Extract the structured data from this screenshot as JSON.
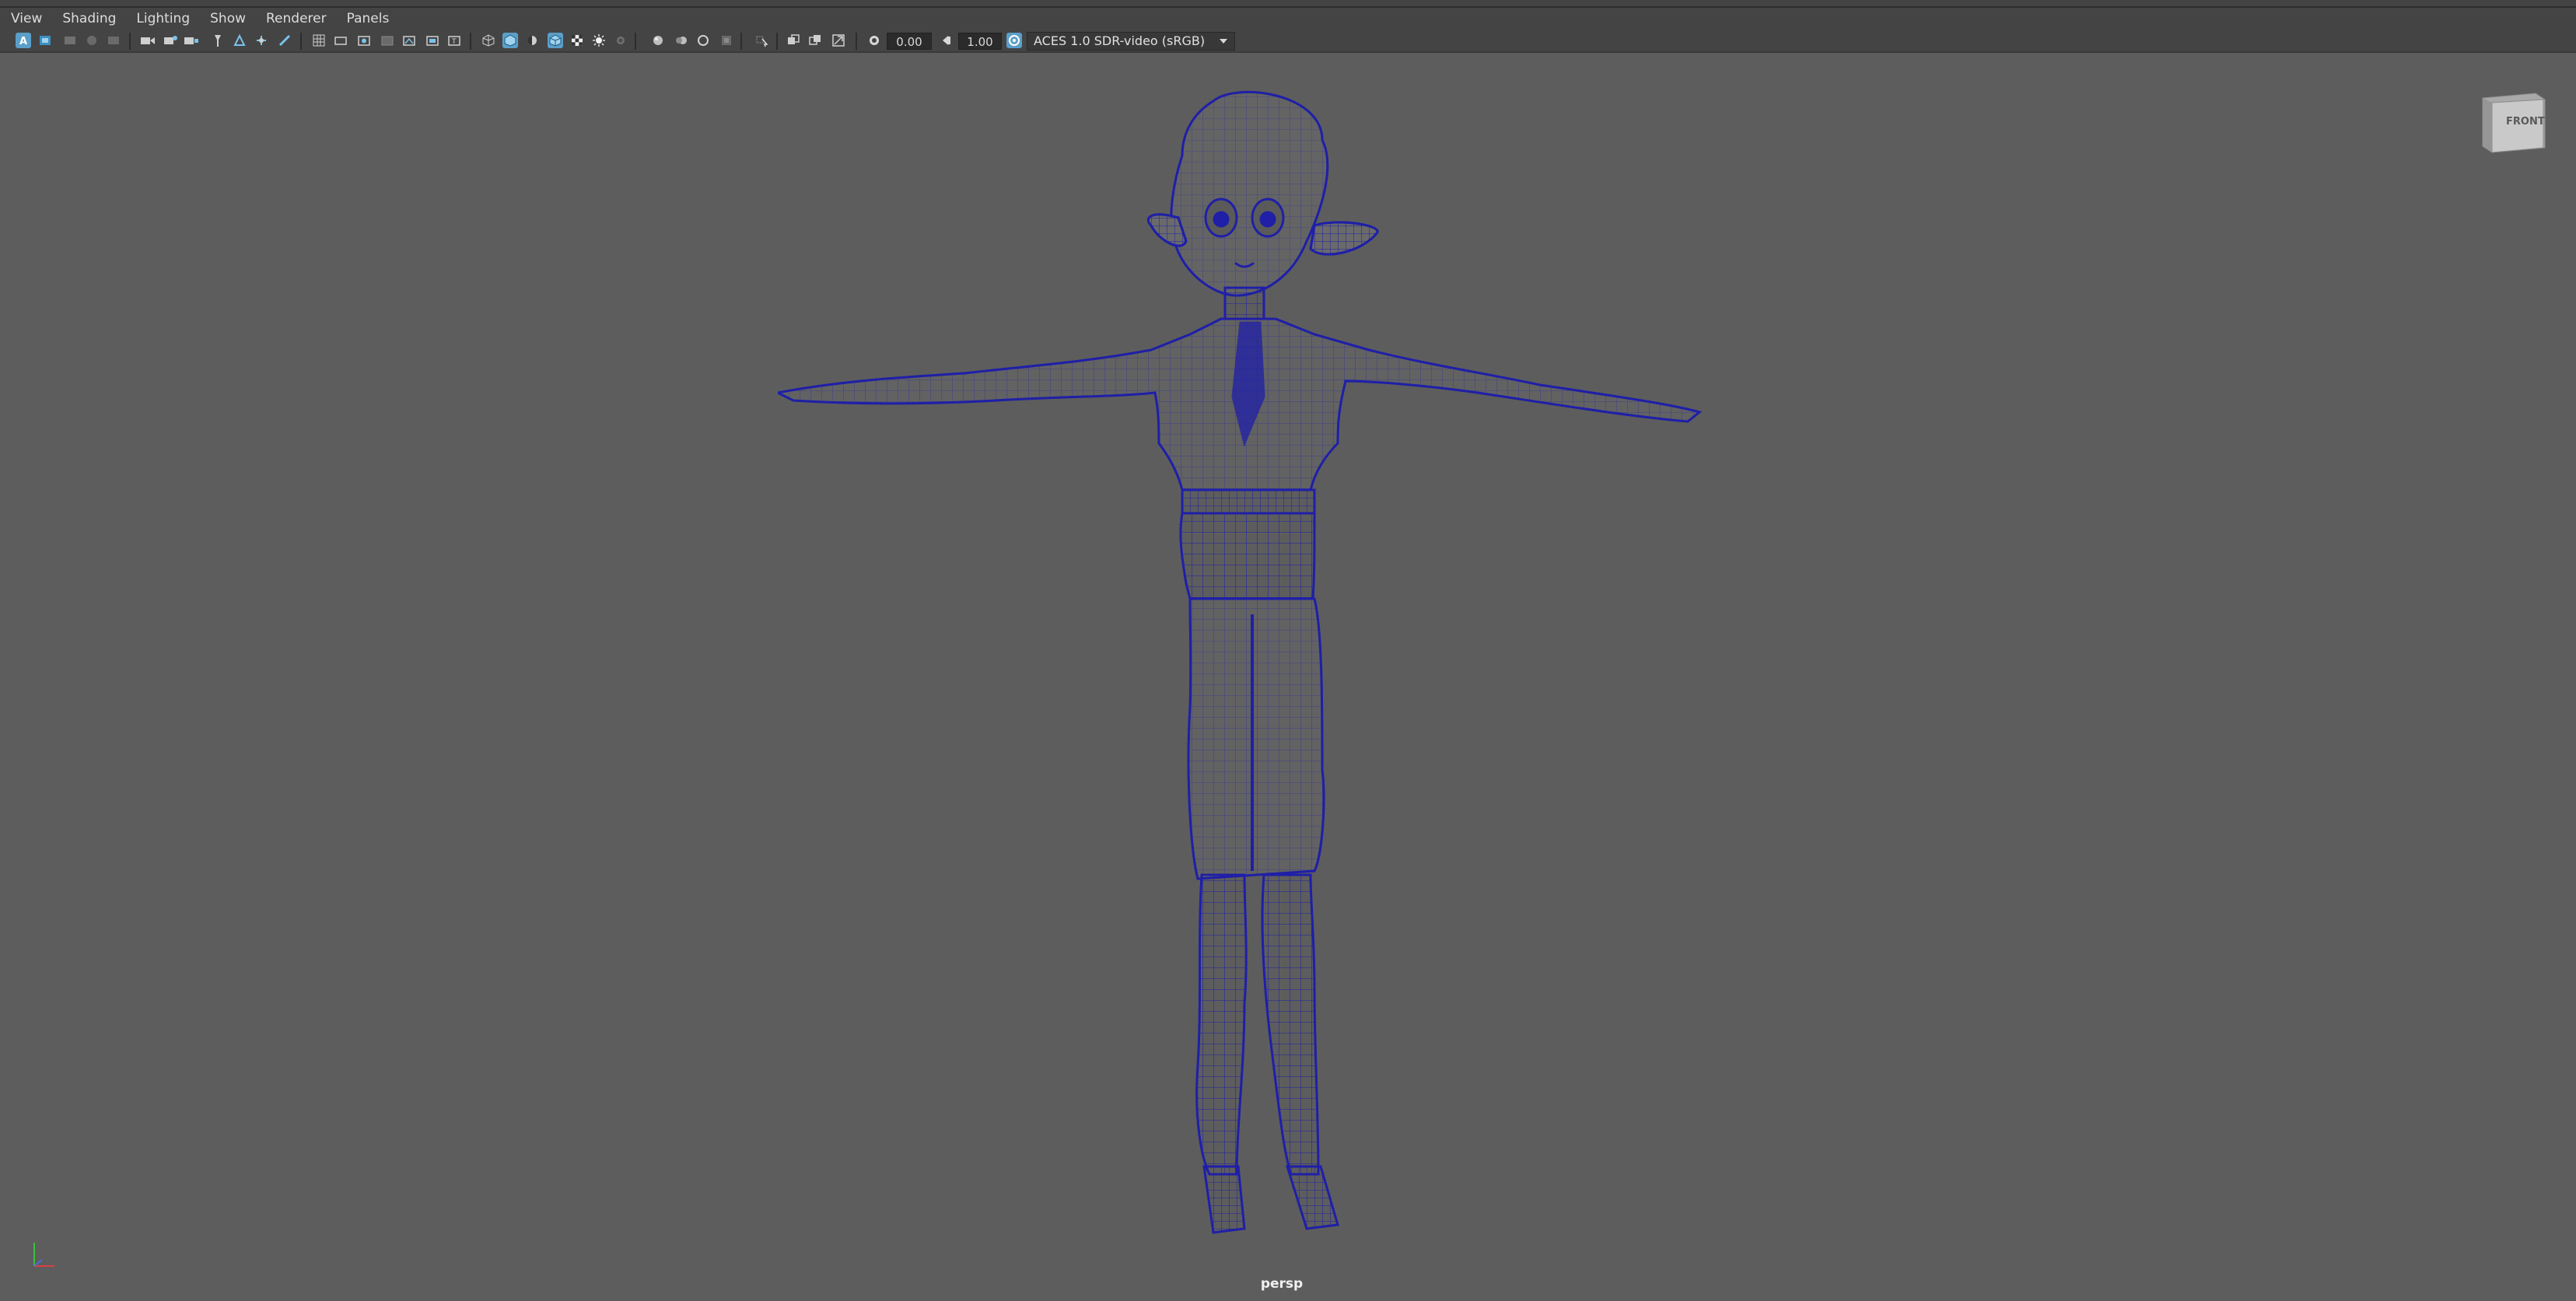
{
  "menu": [
    "View",
    "Shading",
    "Lighting",
    "Show",
    "Renderer",
    "Panels"
  ],
  "toolbar": {
    "exposure_value": "0.00",
    "gamma_value": "1.00",
    "color_space": "ACES 1.0 SDR-video (sRGB)",
    "icons": [
      "select-camera-icon",
      "camera-attributes-icon",
      "bookmark-icon",
      "image-plane-icon",
      "grid-icon",
      "film-gate-icon",
      "resolution-gate-icon",
      "gate-mask-icon",
      "field-chart-icon",
      "safe-action-icon",
      "safe-title-icon",
      "wireframe-icon",
      "smooth-shade-icon",
      "wireframe-on-shaded-icon",
      "textured-icon",
      "use-all-lights-icon",
      "shadows-icon",
      "ambient-occlusion-icon",
      "motion-blur-icon",
      "anti-aliasing-icon",
      "depth-of-field-icon",
      "isolate-select-icon",
      "xray-icon",
      "xray-joints-icon",
      "exposure-icon",
      "gamma-icon",
      "color-management-icon"
    ]
  },
  "viewcube": {
    "face_label": "FRONT"
  },
  "camera": {
    "name": "persp"
  },
  "colors": {
    "viewport_bg": "#5d5d5d",
    "wireframe": "#1f1fa8",
    "ui_bg": "#444444",
    "active_icon": "#5b9fc9"
  }
}
